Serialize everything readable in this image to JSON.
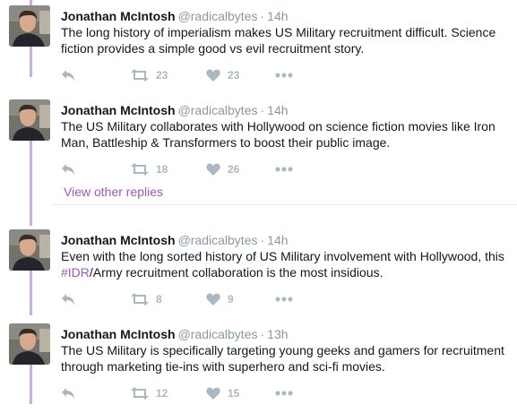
{
  "colors": {
    "thread_line": "#c7afe3",
    "link": "#9b59b6",
    "muted": "#8899a6",
    "action": "#aab8c2"
  },
  "tweets": [
    {
      "author": "Jonathan McIntosh",
      "handle": "@radicalbytes",
      "separator": "·",
      "time": "14h",
      "text_before": "The long history of imperialism makes US Military recruitment difficult. Science fiction provides a simple good vs evil recruitment story.",
      "hashtag": "",
      "text_after": "",
      "retweets": "23",
      "likes": "23"
    },
    {
      "author": "Jonathan McIntosh",
      "handle": "@radicalbytes",
      "separator": "·",
      "time": "14h",
      "text_before": "The US Military collaborates with Hollywood on science fiction movies like Iron Man, Battleship & Transformers to boost their public image.",
      "hashtag": "",
      "text_after": "",
      "retweets": "18",
      "likes": "26"
    },
    {
      "author": "Jonathan McIntosh",
      "handle": "@radicalbytes",
      "separator": "·",
      "time": "14h",
      "text_before": "Even with the long sorted history of US Military involvement with Hollywood, this ",
      "hashtag": "#IDR",
      "text_after": "/Army recruitment collaboration is the most insidious.",
      "retweets": "8",
      "likes": "9"
    },
    {
      "author": "Jonathan McIntosh",
      "handle": "@radicalbytes",
      "separator": "·",
      "time": "13h",
      "text_before": "The US Military is specifically targeting young geeks and gamers for recruitment through marketing tie-ins with superhero and sci-fi movies.",
      "hashtag": "",
      "text_after": "",
      "retweets": "12",
      "likes": "15"
    }
  ],
  "view_other_replies": "View other replies",
  "icons": {
    "reply": "reply-icon",
    "retweet": "retweet-icon",
    "like": "heart-icon",
    "more": "more-dots-icon"
  }
}
